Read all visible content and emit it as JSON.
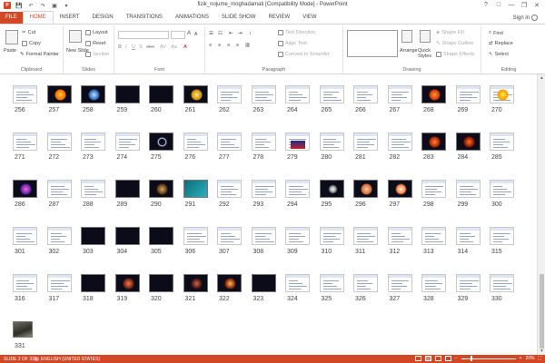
{
  "window": {
    "title": "fizik_nojume_moghadamati [Compatibility Mode] - PowerPoint",
    "controls": [
      "?",
      "□",
      "—",
      "❐",
      "✕"
    ]
  },
  "qat": [
    "P",
    "💾",
    "↶",
    "↷",
    "▣",
    "▾"
  ],
  "tabs": [
    "FILE",
    "HOME",
    "INSERT",
    "DESIGN",
    "TRANSITIONS",
    "ANIMATIONS",
    "SLIDE SHOW",
    "REVIEW",
    "VIEW"
  ],
  "active_tab": "HOME",
  "signin": "Sign in",
  "ribbon": {
    "clipboard": {
      "label": "Clipboard",
      "paste": "Paste",
      "cut": "Cut",
      "copy": "Copy",
      "format_painter": "Format Painter"
    },
    "slides": {
      "label": "Slides",
      "new_slide": "New Slide",
      "layout": "Layout",
      "reset": "Reset",
      "section": "Section"
    },
    "font": {
      "label": "Font"
    },
    "paragraph": {
      "label": "Paragraph",
      "text_direction": "Text Direction",
      "align_text": "Align Text",
      "convert": "Convert to SmartArt"
    },
    "drawing": {
      "label": "Drawing",
      "arrange": "Arrange",
      "quick_styles": "Quick Styles",
      "shape_fill": "Shape Fill",
      "shape_outline": "Shape Outline",
      "shape_effects": "Shape Effects"
    },
    "editing": {
      "label": "Editing",
      "find": "Find",
      "replace": "Replace",
      "select": "Select"
    }
  },
  "slides": [
    256,
    257,
    258,
    259,
    260,
    261,
    262,
    263,
    264,
    265,
    266,
    267,
    268,
    269,
    270,
    271,
    272,
    273,
    274,
    275,
    276,
    277,
    278,
    279,
    280,
    281,
    282,
    283,
    284,
    285,
    286,
    287,
    288,
    289,
    290,
    291,
    292,
    293,
    294,
    295,
    296,
    297,
    298,
    299,
    300,
    301,
    302,
    303,
    304,
    305,
    306,
    307,
    308,
    309,
    310,
    311,
    312,
    313,
    314,
    315,
    316,
    317,
    318,
    319,
    320,
    321,
    322,
    323,
    324,
    325,
    326,
    327,
    328,
    329,
    330,
    331
  ],
  "status": {
    "slide": "SLIDE 2 OF 331",
    "language": "ENGLISH (UNITED STATES)",
    "zoom": "20%",
    "zoom_fraction": 0.2
  }
}
